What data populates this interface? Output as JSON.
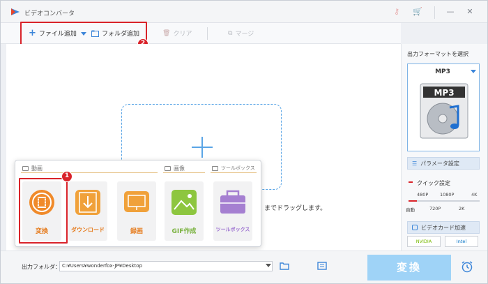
{
  "window": {
    "title": "ビデオコンバータ"
  },
  "toolbar": {
    "add_file": "ファイル追加",
    "add_folder": "フォルダ追加",
    "clear": "クリア",
    "merge": "マージ"
  },
  "badges": {
    "one": "1",
    "two": "2"
  },
  "drop_hint": "までドラッグします。",
  "popup": {
    "section_video": "動画",
    "section_image": "画像",
    "section_tools": "ツールボックス",
    "tiles": [
      {
        "label": "変換",
        "icon": "film-convert-icon",
        "color": "#f08a2a"
      },
      {
        "label": "ダウンロード",
        "icon": "download-icon",
        "color": "#f0a13a"
      },
      {
        "label": "録画",
        "icon": "screen-record-icon",
        "color": "#f0a13a"
      },
      {
        "label": "GIF作成",
        "icon": "image-icon",
        "color": "#8dc63f"
      },
      {
        "label": "ツールボックス",
        "icon": "toolbox-icon",
        "color": "#a57fd1"
      }
    ]
  },
  "right_panel": {
    "title": "出力フォーマットを選択",
    "format": "MP3",
    "param_button": "パラメータ設定",
    "quick_settings": "クイック設定",
    "ticks_top": [
      "480P",
      "1080P",
      "4K"
    ],
    "ticks_bottom": [
      "自動",
      "720P",
      "2K"
    ],
    "gpu_button": "ビデオカード加速",
    "gpu_nvidia": "NVIDIA",
    "gpu_intel": "Intel"
  },
  "bottom": {
    "output_label": "出力フォルダ：",
    "output_path": "C:¥Users¥wonderfox-JP¥Desktop",
    "convert": "変換"
  },
  "colors": {
    "accent_red": "#d9232a",
    "accent_blue": "#3d86d9",
    "convert_button": "#9fd3f7"
  }
}
